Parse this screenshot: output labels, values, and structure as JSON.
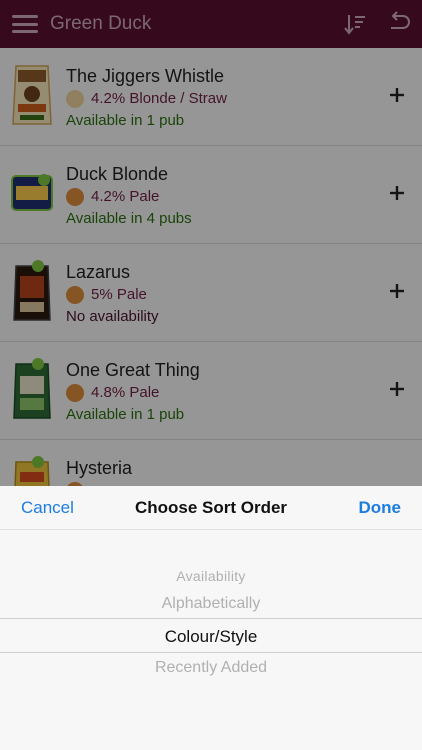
{
  "header": {
    "title": "Green Duck",
    "menu_icon": "hamburger-menu-icon",
    "sort_icon": "sort-descending-icon",
    "back_icon": "undo-arrow-icon"
  },
  "beers": [
    {
      "name": "The Jiggers Whistle",
      "style": "4.2% Blonde / Straw",
      "availability": "Available in 1 pub",
      "colour": "#e8cf9a",
      "avail_color": "#2b6e10"
    },
    {
      "name": "Duck Blonde",
      "style": "4.2% Pale",
      "availability": "Available in 4 pubs",
      "colour": "#d98a3a",
      "avail_color": "#2b6e10"
    },
    {
      "name": "Lazarus",
      "style": "5% Pale",
      "availability": "No availability",
      "colour": "#d98a3a",
      "avail_color": "#4a1330"
    },
    {
      "name": "One Great Thing",
      "style": "4.8% Pale",
      "availability": "Available in 1 pub",
      "colour": "#d98a3a",
      "avail_color": "#2b6e10"
    },
    {
      "name": "Hysteria",
      "style": "",
      "availability": "",
      "colour": "#d98a3a",
      "avail_color": "#2b6e10"
    }
  ],
  "sort_sheet": {
    "cancel": "Cancel",
    "title": "Choose Sort Order",
    "done": "Done",
    "options": [
      "Availability",
      "Alphabetically",
      "Colour/Style",
      "Recently Added"
    ],
    "selected": "Colour/Style"
  }
}
